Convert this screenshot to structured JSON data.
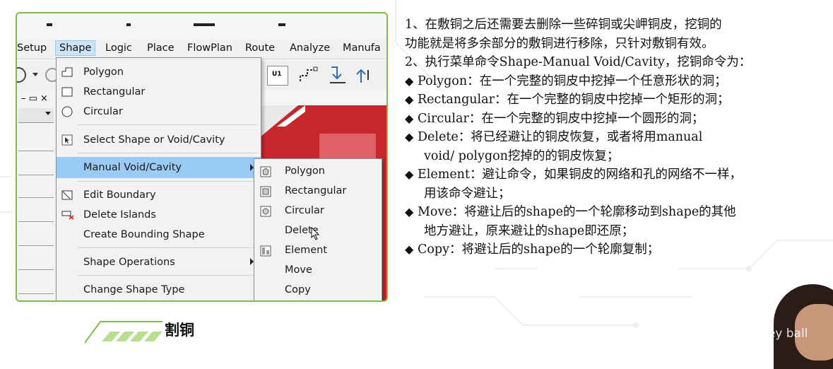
{
  "menubar": {
    "items": [
      "Setup",
      "Shape",
      "Logic",
      "Place",
      "FlowPlan",
      "Route",
      "Analyze",
      "Manufa"
    ],
    "active": "Shape"
  },
  "shape_menu": {
    "items": [
      {
        "label": "Polygon",
        "icon": "polygon-icon"
      },
      {
        "label": "Rectangular",
        "icon": "rectangle-icon"
      },
      {
        "label": "Circular",
        "icon": "circle-icon"
      },
      {
        "label": "Select Shape or Void/Cavity",
        "icon": "select-shape-icon"
      },
      {
        "label": "Manual Void/Cavity",
        "icon": "",
        "highlighted": true,
        "submenu": true
      },
      {
        "label": "Edit Boundary",
        "icon": "edit-boundary-icon"
      },
      {
        "label": "Delete Islands",
        "icon": "delete-islands-icon"
      },
      {
        "label": "Create Bounding Shape",
        "icon": ""
      },
      {
        "label": "Shape Operations",
        "icon": "",
        "submenu": true
      },
      {
        "label": "Change Shape Type",
        "icon": ""
      }
    ]
  },
  "void_submenu": {
    "items": [
      {
        "label": "Polygon",
        "icon": "void-polygon-icon"
      },
      {
        "label": "Rectangular",
        "icon": "void-rectangle-icon"
      },
      {
        "label": "Circular",
        "icon": "void-circle-icon"
      },
      {
        "label": "Delete",
        "icon": ""
      },
      {
        "label": "Element",
        "icon": "element-icon"
      },
      {
        "label": "Move",
        "icon": ""
      },
      {
        "label": "Copy",
        "icon": ""
      }
    ]
  },
  "toolbar": {
    "chip_label": "U1"
  },
  "caption": "割铜",
  "notes": {
    "lines": [
      {
        "text": "1、在敷铜之后还需要去删除一些碎铜或尖岬铜皮，挖铜的",
        "bullet": false,
        "indent": false
      },
      {
        "text": "功能就是将多余部分的敷铜进行移除，只针对敷铜有效。",
        "bullet": false,
        "indent": false
      },
      {
        "text": "2、执行菜单命令Shape-Manual Void/Cavity，挖铜命令为：",
        "bullet": false,
        "indent": false
      },
      {
        "text": "Polygon：在一个完整的铜皮中挖掉一个任意形状的洞；",
        "bullet": true,
        "indent": false
      },
      {
        "text": "Rectangular：在一个完整的铜皮中挖掉一个矩形的洞；",
        "bullet": true,
        "indent": false
      },
      {
        "text": "Circular：在一个完整的铜皮中挖掉一个圆形的洞；",
        "bullet": true,
        "indent": false
      },
      {
        "text": "Delete：将已经避让的铜皮恢复，或者将用manual",
        "bullet": true,
        "indent": false
      },
      {
        "text": "void/ polygon挖掉的的铜皮恢复；",
        "bullet": false,
        "indent": true
      },
      {
        "text": "Element：避让命令，如果铜皮的网络和孔的网络不一样，",
        "bullet": true,
        "indent": false
      },
      {
        "text": "用该命令避让；",
        "bullet": false,
        "indent": true
      },
      {
        "text": "Move：将避让后的shape的一个轮廓移动到shape的其他",
        "bullet": true,
        "indent": false
      },
      {
        "text": "地方避让，原来避让的shape即还原；",
        "bullet": false,
        "indent": true
      },
      {
        "text": "Copy：将避让后的shape的一个轮廓复制；",
        "bullet": true,
        "indent": false
      }
    ],
    "bullet_glyph": "◆"
  },
  "watermark": "CSDN @honey ball",
  "colors": {
    "accent_green": "#7ac142",
    "highlight": "#99cbf5",
    "copper_red": "#c8262d"
  }
}
